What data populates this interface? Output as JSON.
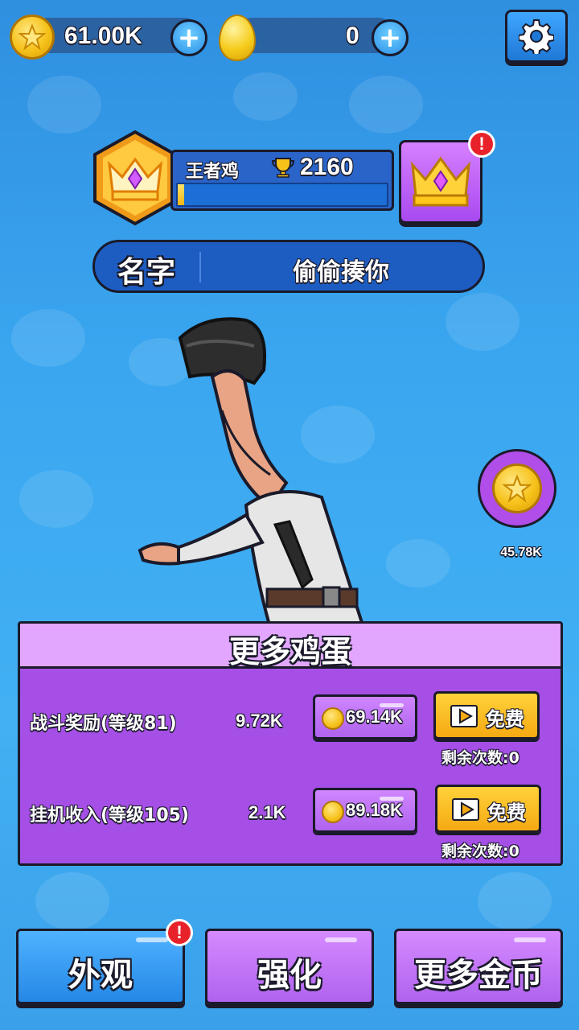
{
  "currency": {
    "coins": "61.00K",
    "eggs": "0"
  },
  "rank": {
    "title": "王者鸡",
    "score": "2160",
    "progress": 0.03
  },
  "profile": {
    "name_label": "名字",
    "name_value": "偷偷揍你"
  },
  "side_coin": {
    "value": "45.78K"
  },
  "panel": {
    "title": "更多鸡蛋",
    "rows": [
      {
        "label": "战斗奖励(等级81)",
        "value": "9.72K",
        "cost": "69.14K",
        "free_label": "免费",
        "remaining": "剩余次数:0"
      },
      {
        "label": "挂机收入(等级105)",
        "value": "2.1K",
        "cost": "89.18K",
        "free_label": "免费",
        "remaining": "剩余次数:0"
      }
    ]
  },
  "bottom_nav": {
    "appearance": "外观",
    "upgrade": "强化",
    "more_coins": "更多金币"
  },
  "colors": {
    "background": "#3aa6f0",
    "panel": "#a54fe6",
    "accent_yellow": "#f6c21a",
    "alert_red": "#e8222b"
  }
}
